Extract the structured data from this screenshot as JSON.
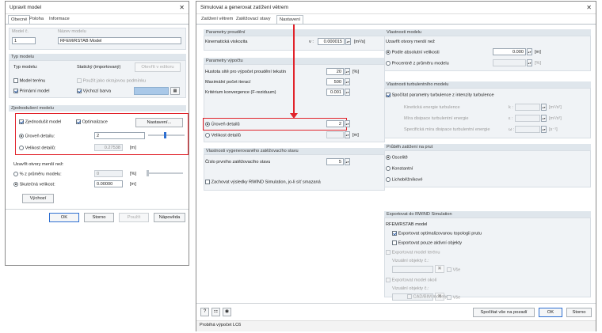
{
  "left": {
    "title": "Upravit model",
    "tabs": [
      "Obecné",
      "Poloha",
      "Informace"
    ],
    "model_no_label": "Model č.",
    "model_no_value": "1",
    "model_name_label": "Název modelu",
    "model_name_value": "RFEM/RSTAB Model",
    "type_section": "Typ modelu",
    "type_label": "Typ modelu:",
    "type_value": "Statický (importovaný)",
    "open_editor": "Otevřít v editoru",
    "terrain_model": "Model terénu",
    "use_as_surroundings": "Použít jako okrajovou podmínku",
    "primary_model": "Primární model",
    "default_color": "Výchozí barva",
    "simplify_section": "Zjednodušení modelu",
    "simplify_model": "Zjednodušit model",
    "optimization": "Optimalizace",
    "settings_btn": "Nastavení...",
    "detail_level": "Úroveň detailu:",
    "detail_level_value": "2",
    "detail_size": "Velikost detailů:",
    "detail_size_value": "0.27538",
    "detail_size_unit": "[m]",
    "close_openings": "Uzavřít otvory menší než:",
    "percent_label": "% z průměru modelu:",
    "percent_value": "0",
    "percent_unit": "[%]",
    "actual_size": "Skutečná velikost:",
    "actual_value": "0.00000",
    "actual_unit": "[m]",
    "default_btn": "Výchozí",
    "ok": "OK",
    "cancel": "Storno",
    "apply": "Použít",
    "help": "Nápověda"
  },
  "right": {
    "title": "Simulovat a generovat zatížení větrem",
    "tabs": [
      "Zatížení větrem",
      "Zatěžovací stavy",
      "Nastavení"
    ],
    "flow": {
      "head": "Parametry proudění",
      "kin_visc": "Kinematická viskozita",
      "nu": "ν :",
      "nu_value": "0.000015",
      "nu_unit": "[m²/s]"
    },
    "calc": {
      "head": "Parametry výpočtu",
      "mesh_density": "Hustota sítě pro výpočet proudění tekutin",
      "mesh_value": "20",
      "mesh_unit": "[%]",
      "max_iter": "Maximální počet iterací",
      "max_iter_value": "500",
      "conv": "Kritérium konvergence (F-reziduum)",
      "conv_value": "0.001",
      "detail_level": "Úroveň detailů",
      "detail_value": "2",
      "detail_size": "Velikost detailů",
      "detail_size_unit": "[m]"
    },
    "generated": {
      "head": "Vlastnosti vygenerovaného zatěžovacího stavu",
      "first_lc": "Číslo prvního zatěžovacího stavu",
      "first_lc_value": "5",
      "keep_results": "Zachovat výsledky RWIND Simulation, jo-li síť smazaná"
    },
    "model_props": {
      "head": "Vlastnosti modelu",
      "close_openings": "Uzavřít otvory menší než",
      "by_absolute": "Podle absolutní velikosti",
      "abs_value": "0.000",
      "abs_unit": "[m]",
      "by_percent": "Procentně z průměru modelu",
      "pct_unit": "[%]"
    },
    "turb": {
      "head": "Vlastnosti turbulentního modelu",
      "calc_turb": "Spočítat parametry turbulence z intenzity turbulence",
      "k_label": "Kinetická energie turbulence",
      "k_sym": "k :",
      "k_unit": "[m²/s²]",
      "eps_label": "Míra disipace turbulentní energie",
      "eps_sym": "ε :",
      "eps_unit": "[m²/s³]",
      "omega_label": "Specifická míra disipace turbulentní energie",
      "omega_sym": "ω :",
      "omega_unit": "[s⁻¹]"
    },
    "rod": {
      "head": "Průběh zatížení na prut",
      "opt1": "Oscelitě",
      "opt2": "Konstantní",
      "opt3": "Lichoběžníkové"
    },
    "export": {
      "head": "Exportovat do RWIND Simulation",
      "rfem_model": "RFEM/RSTAB model",
      "export_opt": "Exportovat optimalizovanou topologii prutu",
      "export_active": "Exportovat pouze aktivní objekty",
      "export_terrain": "Exportovat model terénu",
      "visual_objects": "Vizuální objekty č.:",
      "all": "Vše",
      "export_surround": "Exportovat model okolí",
      "visual_objects2": "Vizuální objekty č.:",
      "all2": "Vše",
      "cad_bim": "CAD/BIM modely"
    },
    "calc_all_bg": "Spočítat vše na pozadí",
    "ok": "OK",
    "cancel": "Storno",
    "status": "Probíhá výpočet LC6"
  }
}
